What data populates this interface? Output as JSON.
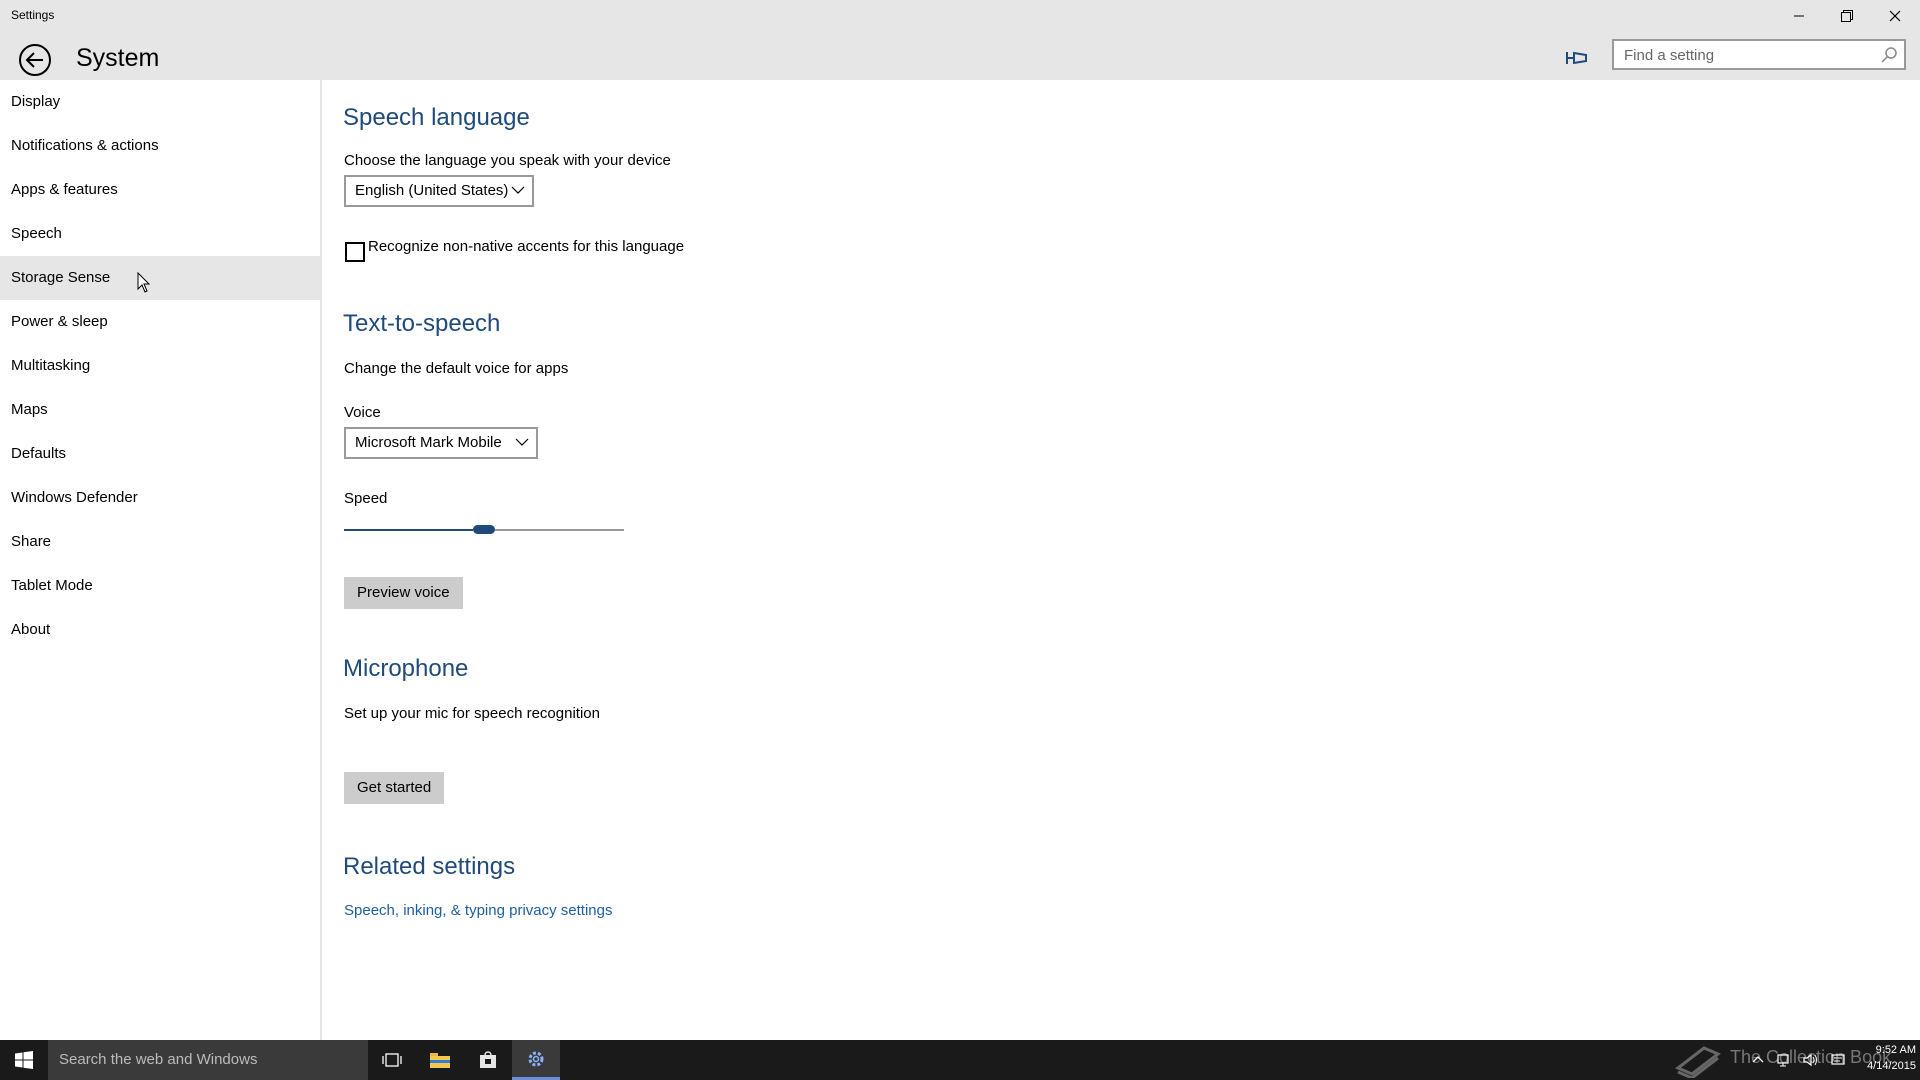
{
  "window": {
    "title": "Settings"
  },
  "header": {
    "page_title": "System",
    "search_placeholder": "Find a setting"
  },
  "sidebar": {
    "items": [
      {
        "label": "Display"
      },
      {
        "label": "Notifications & actions"
      },
      {
        "label": "Apps & features"
      },
      {
        "label": "Speech"
      },
      {
        "label": "Storage Sense"
      },
      {
        "label": "Power & sleep"
      },
      {
        "label": "Multitasking"
      },
      {
        "label": "Maps"
      },
      {
        "label": "Defaults"
      },
      {
        "label": "Windows Defender"
      },
      {
        "label": "Share"
      },
      {
        "label": "Tablet Mode"
      },
      {
        "label": "About"
      }
    ],
    "hovered_item": "Storage Sense"
  },
  "speech_language": {
    "heading": "Speech language",
    "description": "Choose the language you speak with your device",
    "language_value": "English (United States)",
    "accent_checkbox_label": "Recognize non-native accents for this language",
    "accent_checked": false
  },
  "text_to_speech": {
    "heading": "Text-to-speech",
    "description": "Change the default voice for apps",
    "voice_label": "Voice",
    "voice_value": "Microsoft Mark Mobile",
    "speed_label": "Speed",
    "speed_level": 0.5,
    "preview_button": "Preview voice"
  },
  "microphone": {
    "heading": "Microphone",
    "description": "Set up your mic for speech recognition",
    "button": "Get started"
  },
  "related": {
    "heading": "Related settings",
    "link": "Speech, inking, & typing privacy settings"
  },
  "taskbar": {
    "search_text": "Search the web and Windows",
    "watermark_text": "The Collection Book",
    "time": "9:52 AM",
    "date": "4/14/2015"
  },
  "colors": {
    "accent": "#1f4a7a",
    "link": "#1f5fa0",
    "chrome": "#e6e6e6",
    "taskbar": "#1a1a1a"
  },
  "icons": [
    "back-arrow-icon",
    "pin-icon",
    "search-icon",
    "minimize-icon",
    "maximize-icon",
    "close-icon",
    "chevron-down-icon",
    "windows-logo-icon",
    "task-view-icon",
    "file-explorer-icon",
    "store-icon",
    "settings-gear-icon",
    "book-icon",
    "chevron-up-icon",
    "network-icon",
    "volume-icon",
    "action-center-icon"
  ]
}
